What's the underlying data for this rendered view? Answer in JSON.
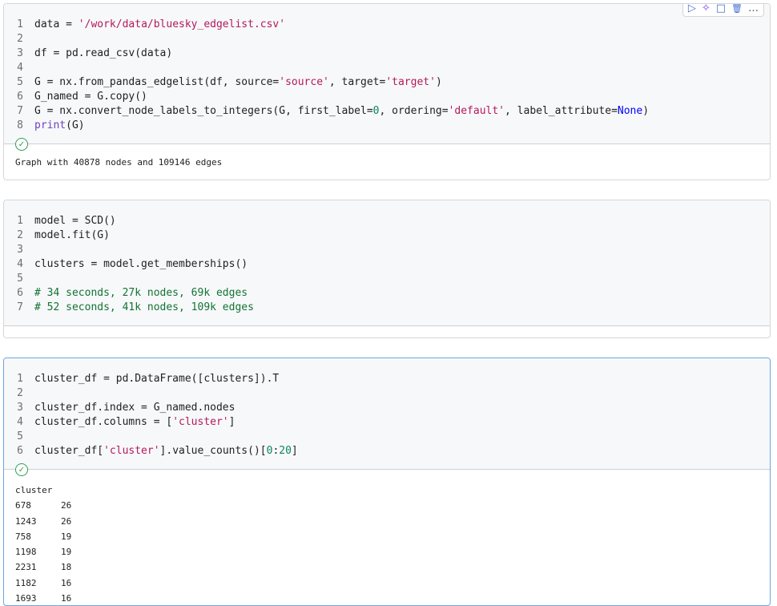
{
  "toolbar": {
    "run_icon": "▷",
    "ai_icon": "✧",
    "comment_icon": "□",
    "delete_icon": "🗑",
    "more_icon": "…"
  },
  "cells": [
    {
      "code": [
        "data = '/work/data/bluesky_edgelist.csv'",
        "",
        "df = pd.read_csv(data)",
        "",
        "G = nx.from_pandas_edgelist(df, source='source', target='target')",
        "G_named = G.copy()",
        "G = nx.convert_node_labels_to_integers(G, first_label=0, ordering='default', label_attribute=None)",
        "print(G)"
      ],
      "output": "Graph with 40878 nodes and 109146 edges"
    },
    {
      "code": [
        "model = SCD()",
        "model.fit(G)",
        "",
        "clusters = model.get_memberships()",
        "",
        "# 34 seconds, 27k nodes, 69k edges",
        "# 52 seconds, 41k nodes, 109k edges"
      ]
    },
    {
      "code": [
        "cluster_df = pd.DataFrame([clusters]).T",
        "",
        "cluster_df.index = G_named.nodes",
        "cluster_df.columns = ['cluster']",
        "",
        "cluster_df['cluster'].value_counts()[0:20]"
      ],
      "output_header": "cluster",
      "output_rows": [
        [
          "678",
          "26"
        ],
        [
          "1243",
          "26"
        ],
        [
          "758",
          "19"
        ],
        [
          "1198",
          "19"
        ],
        [
          "2231",
          "18"
        ],
        [
          "1182",
          "16"
        ],
        [
          "1693",
          "16"
        ]
      ]
    }
  ]
}
